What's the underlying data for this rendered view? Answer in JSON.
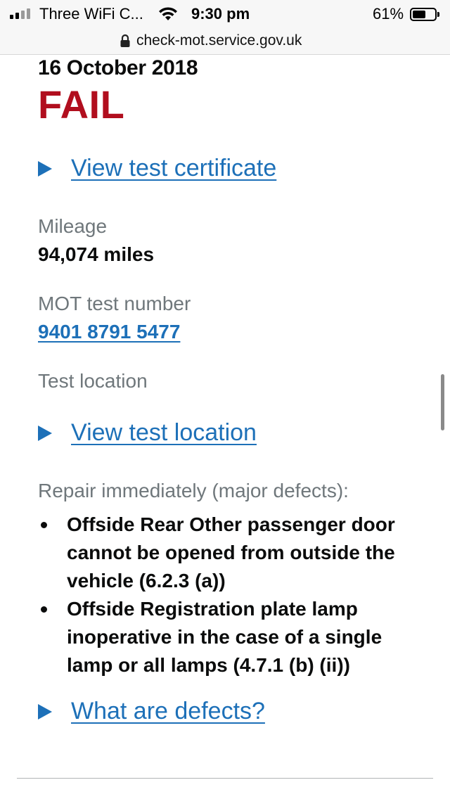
{
  "status_bar": {
    "carrier": "Three WiFi C...",
    "time": "9:30 pm",
    "battery_percent": "61%",
    "battery_level": 0.61,
    "icons": [
      "signal-icon",
      "wifi-icon",
      "battery-icon"
    ]
  },
  "browser": {
    "url": "check-mot.service.gov.uk"
  },
  "test": {
    "date": "16 October 2018",
    "result": "FAIL",
    "view_certificate": "View test certificate",
    "mileage_label": "Mileage",
    "mileage_value": "94,074 miles",
    "test_number_label": "MOT test number",
    "test_number_value": "9401 8791 5477",
    "location_label": "Test location",
    "view_location": "View test location",
    "defects_heading": "Repair immediately (major defects):",
    "defects": [
      "Offside Rear Other passenger door cannot be opened from outside the vehicle (6.2.3 (a))",
      "Offside Registration plate lamp inoperative in the case of a single lamp or all lamps (4.7.1 (b) (ii))"
    ],
    "what_are_defects": "What are defects?"
  },
  "colors": {
    "fail": "#b10e1e",
    "link": "#1d70b8",
    "secondary_text": "#6f777b",
    "text": "#0b0c0c"
  }
}
